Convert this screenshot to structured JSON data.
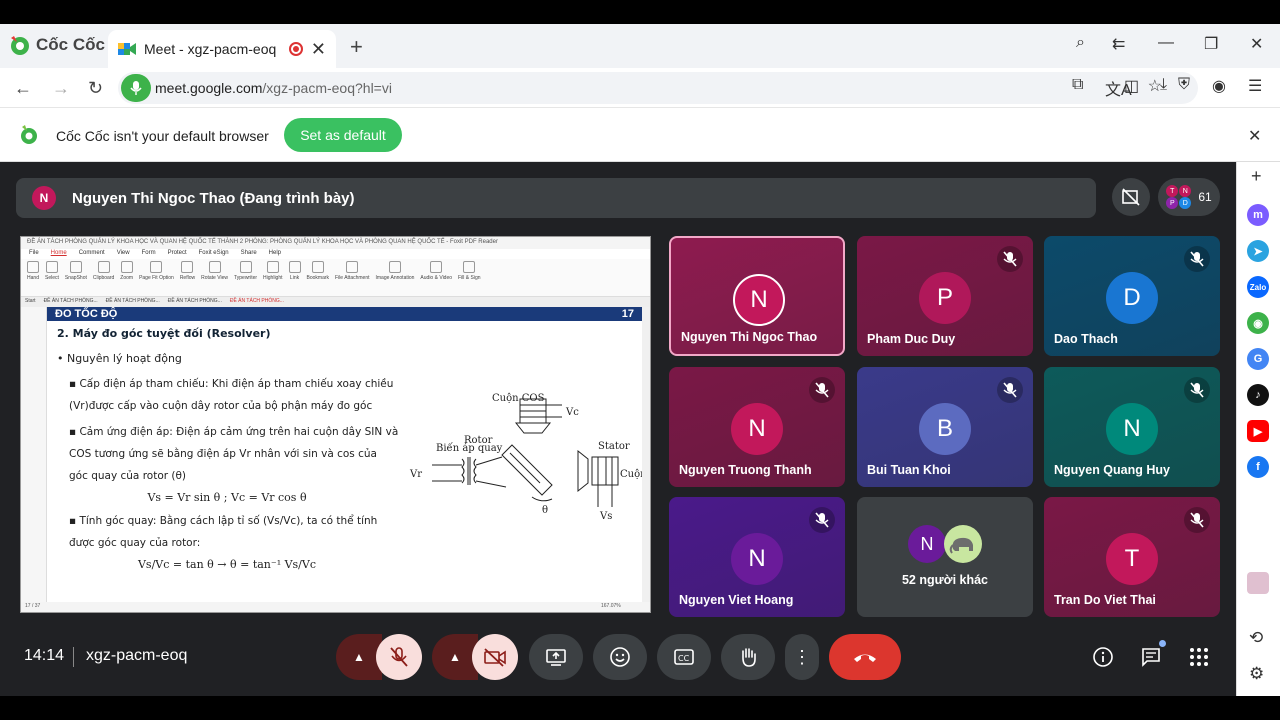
{
  "browser": {
    "brand": "Cốc Cốc",
    "tab_title": "Meet - xgz-pacm-eoq",
    "url_host": "meet.google.com",
    "url_path": "/xgz-pacm-eoq?hl=vi",
    "infobar_text": "Cốc Cốc isn't your default browser",
    "infobar_button": "Set as default"
  },
  "meet": {
    "presenter_initial": "N",
    "presenter_label": "Nguyen Thi Ngoc Thao (Đang trình bày)",
    "participant_count": "61",
    "time": "14:14",
    "meeting_code": "xgz-pacm-eoq",
    "others_label": "52 người khác",
    "others_initial": "N",
    "tiles": [
      {
        "initial": "N",
        "name": "Nguyen Thi Ngoc Thao",
        "bg": "#8e1b4f",
        "av": "#c2185b",
        "muted": false
      },
      {
        "initial": "P",
        "name": "Pham Duc Duy",
        "bg": "#7a1846",
        "av": "#b0185a",
        "muted": true
      },
      {
        "initial": "D",
        "name": "Dao Thach",
        "bg": "#0c4a6a",
        "av": "#1976d2",
        "muted": true
      },
      {
        "initial": "N",
        "name": "Nguyen Truong Thanh",
        "bg": "#7a1846",
        "av": "#c2185b",
        "muted": true
      },
      {
        "initial": "B",
        "name": "Bui Tuan Khoi",
        "bg": "#3a3a8a",
        "av": "#5c6bc0",
        "muted": true
      },
      {
        "initial": "N",
        "name": "Nguyen Quang Huy",
        "bg": "#0d5a5a",
        "av": "#00897b",
        "muted": true
      },
      {
        "initial": "N",
        "name": "Nguyen Viet Hoang",
        "bg": "#4a1a8a",
        "av": "#6a1b9a",
        "muted": true
      },
      {
        "initial": "T",
        "name": "Tran Do Viet Thai",
        "bg": "#7a1846",
        "av": "#c2185b",
        "muted": true
      }
    ]
  },
  "slide": {
    "header_title": "ĐO TỐC ĐỘ",
    "page_no": "17",
    "heading": "2. Máy đo góc tuyệt đối (Resolver)",
    "bullet1": "Nguyên lý hoạt động",
    "sub1": "Cấp điện áp tham chiếu: Khi điện áp tham chiếu xoay chiều (Vr)được cấp vào cuộn dây rotor của bộ phận máy đo góc",
    "sub2": "Cảm ứng điện áp: Điện áp cảm ứng trên hai cuộn dây SIN và COS tương ứng sẽ bằng điện áp Vr nhân với sin và cos của góc quay của rotor (θ)",
    "formula1": "Vs = Vr sin θ ; Vc = Vr cos θ",
    "sub3": "Tính góc quay: Bằng cách lập tỉ số (Vs/Vc), ta có thể tính được góc quay của rotor:",
    "formula2": "Vs/Vc = tan θ → θ = tan⁻¹ Vs/Vc",
    "diagram_labels": {
      "cuon_cos": "Cuộn COS",
      "vc": "Vc",
      "rotor": "Rotor",
      "stator": "Stator",
      "bien_ap": "Biến áp quay",
      "cuon_sin": "Cuộn SIN",
      "vr": "Vr",
      "vs": "Vs",
      "theta": "θ"
    }
  },
  "foxit": {
    "title_text": "ĐỀ ÁN TÁCH PHÒNG QUẢN LÝ KHOA HỌC VÀ QUAN HỆ QUỐC TẾ THÀNH 2 PHÒNG: PHÒNG QUẢN LÝ KHOA HỌC VÀ PHÒNG QUAN HỆ QUỐC TẾ - Foxit PDF Reader",
    "menu": [
      "File",
      "Home",
      "Comment",
      "View",
      "Form",
      "Protect",
      "Foxit eSign",
      "Share",
      "Help"
    ],
    "ribbon": [
      "Hand",
      "Select",
      "SnapShot",
      "Clipboard",
      "Zoom",
      "Page Fit Option",
      "Reflow",
      "Rotate View",
      "Typewriter",
      "Highlight",
      "Link",
      "Bookmark",
      "File Attachment",
      "Image Annotation",
      "Audio & Video",
      "Fill & Sign"
    ],
    "tabs": [
      "Start",
      "ĐỀ ÁN TÁCH PHÒNG...",
      "ĐỀ ÁN TÁCH PHÒNG...",
      "ĐỀ ÁN TÁCH PHÒNG...",
      "ĐỀ ÁN TÁCH PHÒNG..."
    ],
    "status_page": "17 / 37",
    "status_zoom": "167.07%"
  }
}
